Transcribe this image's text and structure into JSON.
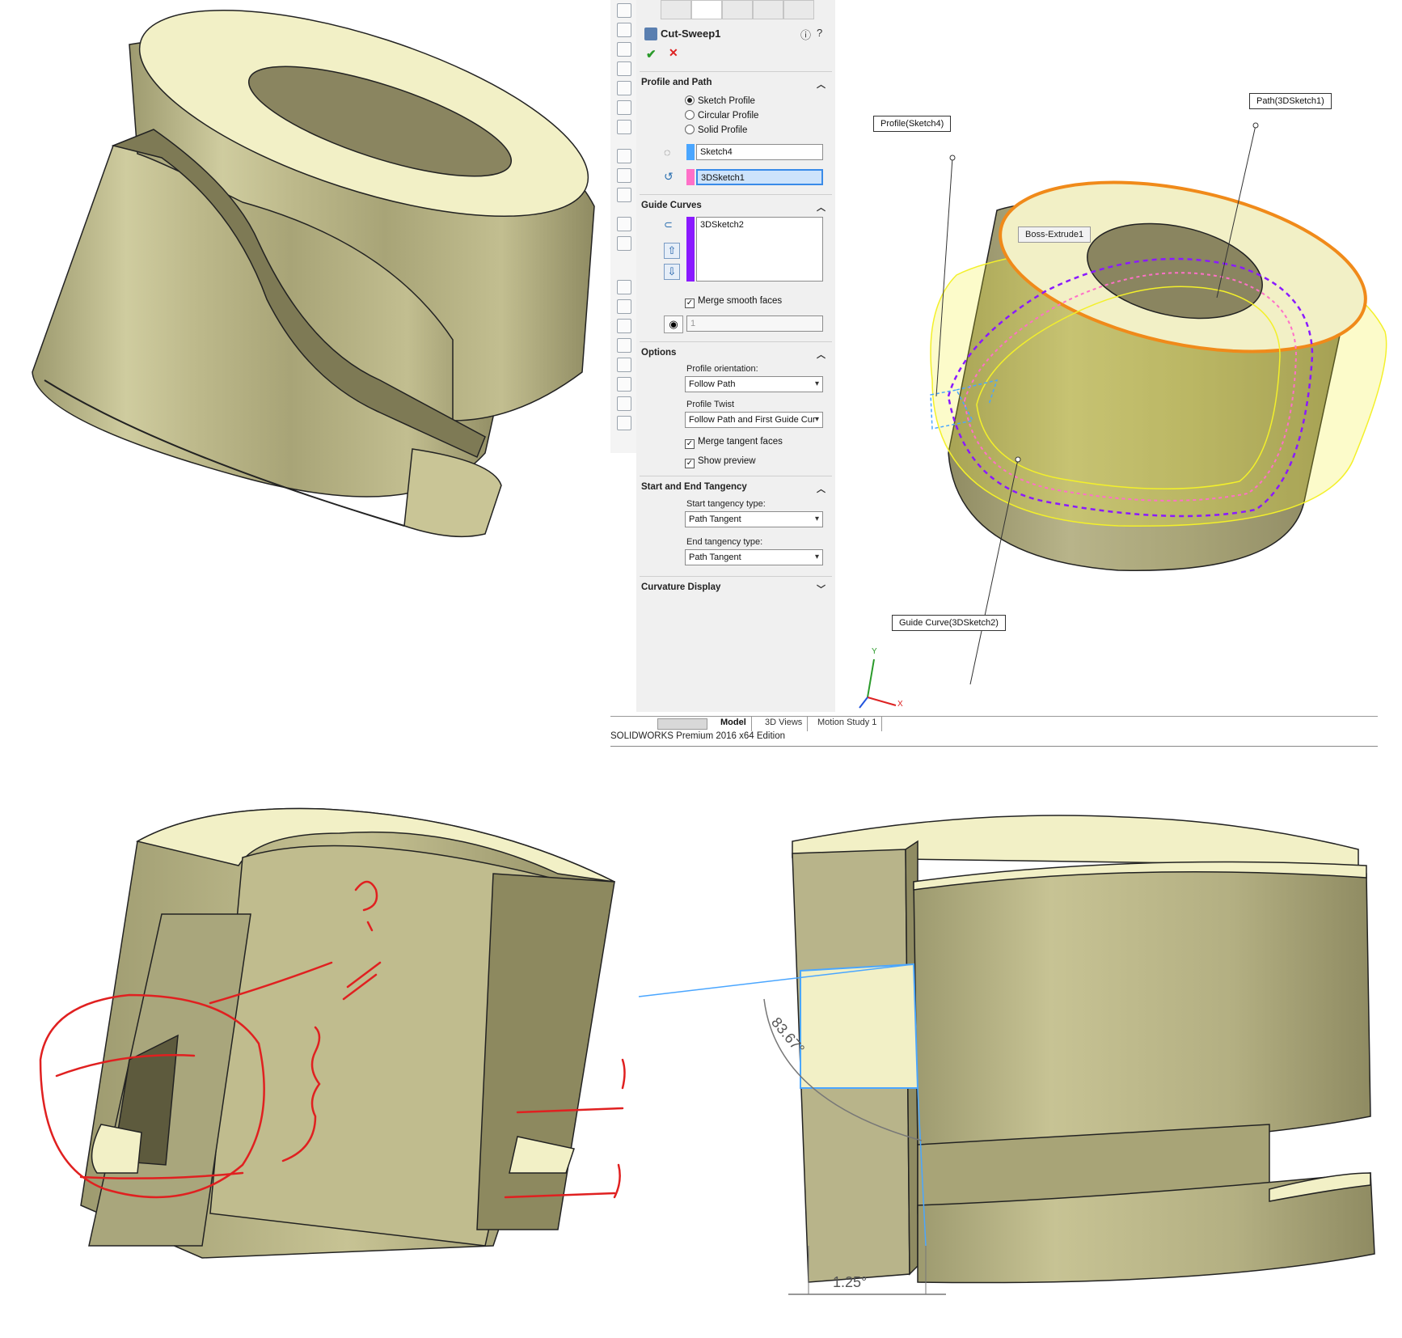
{
  "window": {
    "status_bar": "SOLIDWORKS Premium 2016 x64 Edition",
    "bottom_tabs": [
      "Model",
      "3D Views",
      "Motion Study 1"
    ]
  },
  "property_manager": {
    "feature_title": "Cut-Sweep1",
    "profile_and_path": {
      "heading": "Profile and Path",
      "radio_options": [
        "Sketch Profile",
        "Circular Profile",
        "Solid Profile"
      ],
      "selected_radio": "Sketch Profile",
      "profile_value": "Sketch4",
      "path_value": "3DSketch1"
    },
    "guide_curves": {
      "heading": "Guide Curves",
      "items": [
        "3DSketch2"
      ],
      "merge_smooth_faces_label": "Merge smooth faces",
      "merge_smooth_faces": true,
      "spin_value": "1"
    },
    "options": {
      "heading": "Options",
      "profile_orientation_label": "Profile orientation:",
      "profile_orientation_value": "Follow Path",
      "profile_twist_label": "Profile Twist",
      "profile_twist_value": "Follow Path and First Guide Cur",
      "merge_tangent_faces_label": "Merge tangent faces",
      "merge_tangent_faces": true,
      "show_preview_label": "Show preview",
      "show_preview": true
    },
    "tangency": {
      "heading": "Start and End Tangency",
      "start_label": "Start tangency type:",
      "start_value": "Path Tangent",
      "end_label": "End tangency type:",
      "end_value": "Path Tangent"
    },
    "curvature": {
      "heading": "Curvature Display"
    }
  },
  "graphics_area": {
    "callouts": {
      "profile": "Profile(Sketch4)",
      "path": "Path(3DSketch1)",
      "boss": "Boss-Extrude1",
      "guide": "Guide Curve(3DSketch2)"
    },
    "triad_labels": [
      "Y",
      "X"
    ]
  },
  "lower_right_view": {
    "angle_dimension": "83.67°",
    "linear_dimension": "1.25°"
  },
  "lower_left_view": {
    "annotation_color": "#e02020"
  },
  "colors": {
    "part_body": "#b8b48a",
    "part_top": "#f2f0c6",
    "part_dark": "#8a8560",
    "selection_orange": "#f08a1a",
    "preview_yellow": "#f3f02a",
    "guide_purple": "#8a1aff",
    "path_pink": "#ff70c8",
    "sketch_blue": "#4aa6ff"
  }
}
